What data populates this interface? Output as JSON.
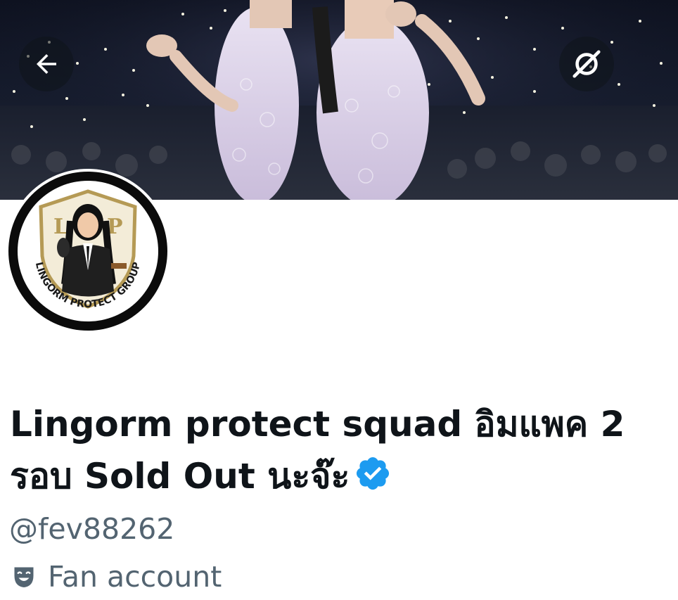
{
  "profile": {
    "display_name": "Lingorm protect squad อิมแพค 2 รอบ Sold Out นะจ๊ะ",
    "handle": "@fev88262",
    "category": "Fan account",
    "verified": true,
    "avatar_text": "LINGORM PROTECT GROUP"
  },
  "header": {
    "back_icon": "back-arrow-icon",
    "more_icon": "more-icon"
  },
  "colors": {
    "text_primary": "#0f1419",
    "text_secondary": "#536471",
    "verified_blue": "#1d9bf0"
  }
}
